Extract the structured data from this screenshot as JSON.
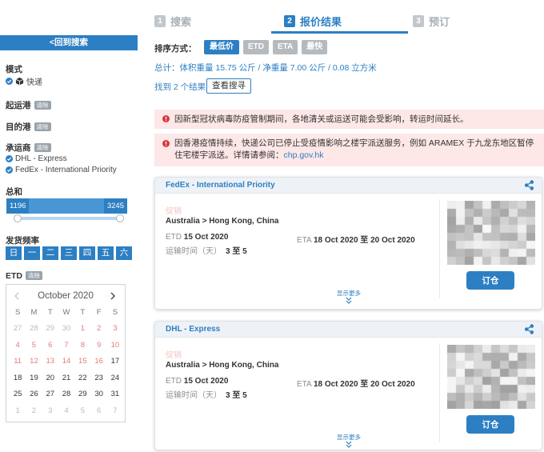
{
  "colors": {
    "primary": "#2d7fc3",
    "primary_dark": "#236aa6",
    "alert_bg": "#fde7e7",
    "alert_red": "#d9363e",
    "step_gray": "#c2c7cc",
    "btn_gray": "#b5babf",
    "past_day": "#e27d7d",
    "promo": "#f3c3c3"
  },
  "icons": {
    "mode": "cube-icon",
    "check": "check-circle-icon",
    "alert": "exclamation-circle-icon",
    "share": "share-icon",
    "more": "double-chevron-down-icon"
  },
  "steps": [
    {
      "num": "1",
      "label": "搜索",
      "active": false
    },
    {
      "num": "2",
      "label": "报价结果",
      "active": true
    },
    {
      "num": "3",
      "label": "预订",
      "active": false
    }
  ],
  "sidebar": {
    "back_button": "<回到搜索",
    "mode": {
      "label": "模式",
      "value": "快递"
    },
    "origin": {
      "label": "起运港",
      "clear": "清除"
    },
    "destination": {
      "label": "目的港",
      "clear": "清除"
    },
    "carrier": {
      "label": "承运商",
      "clear": "清除",
      "options": [
        "DHL - Express",
        "FedEx - International Priority"
      ]
    },
    "total": {
      "label": "总和",
      "min": "1196",
      "max": "3245"
    },
    "frequency": {
      "label": "发货频率",
      "days": [
        "日",
        "一",
        "二",
        "三",
        "四",
        "五",
        "六"
      ]
    },
    "etd": {
      "label": "ETD",
      "clear": "清除"
    },
    "calendar": {
      "month": "October 2020",
      "weekdays": [
        "S",
        "M",
        "T",
        "W",
        "T",
        "F",
        "S"
      ],
      "weeks": [
        [
          {
            "d": "27",
            "muted": true
          },
          {
            "d": "28",
            "muted": true
          },
          {
            "d": "29",
            "muted": true
          },
          {
            "d": "30",
            "muted": true
          },
          {
            "d": "1",
            "past": true
          },
          {
            "d": "2",
            "past": true
          },
          {
            "d": "3",
            "past": true
          }
        ],
        [
          {
            "d": "4",
            "past": true
          },
          {
            "d": "5",
            "past": true
          },
          {
            "d": "6",
            "past": true
          },
          {
            "d": "7",
            "past": true
          },
          {
            "d": "8",
            "past": true
          },
          {
            "d": "9",
            "past": true
          },
          {
            "d": "10",
            "past": true
          }
        ],
        [
          {
            "d": "11",
            "past": true
          },
          {
            "d": "12",
            "past": true
          },
          {
            "d": "13",
            "past": true
          },
          {
            "d": "14",
            "past": true
          },
          {
            "d": "15",
            "past": true
          },
          {
            "d": "16",
            "past": true
          },
          {
            "d": "17"
          }
        ],
        [
          {
            "d": "18"
          },
          {
            "d": "19"
          },
          {
            "d": "20"
          },
          {
            "d": "21"
          },
          {
            "d": "22"
          },
          {
            "d": "23"
          },
          {
            "d": "24"
          }
        ],
        [
          {
            "d": "25"
          },
          {
            "d": "26"
          },
          {
            "d": "27"
          },
          {
            "d": "28"
          },
          {
            "d": "29"
          },
          {
            "d": "30"
          },
          {
            "d": "31"
          }
        ],
        [
          {
            "d": "1",
            "muted": true
          },
          {
            "d": "2",
            "muted": true
          },
          {
            "d": "3",
            "muted": true
          },
          {
            "d": "4",
            "muted": true
          },
          {
            "d": "5",
            "muted": true
          },
          {
            "d": "6",
            "muted": true
          },
          {
            "d": "7",
            "muted": true
          }
        ]
      ]
    }
  },
  "sort": {
    "label": "排序方式：",
    "options": [
      "最低价",
      "ETD",
      "ETA",
      "最快"
    ],
    "active_index": 0
  },
  "summary": "总计：体积重量 15.75 公斤 / 净重量 7.00 公斤 / 0.08 立方米",
  "results": {
    "count_text": "找到 2 个结果",
    "view_search": "查看搜寻"
  },
  "alerts": [
    {
      "text": "因新型冠状病毒防疫管制期间，各地清关或运送可能会受影响，转运时间延长。"
    },
    {
      "text": "因香港疫情持续，快递公司已停止受疫情影响之楼宇派送服务，例如 ARAMEX 于九龙东地区暂停住宅楼宇派送。详情请参阅：",
      "link": "chp.gov.hk"
    }
  ],
  "cards": [
    {
      "carrier": "FedEx - International Priority",
      "promo": "促销",
      "route": "Australia > Hong Kong, China",
      "etd": {
        "label": "ETD",
        "value": "15 Oct 2020"
      },
      "eta": {
        "label": "ETA",
        "value": "18 Oct 2020 至 20 Oct 2020"
      },
      "transit": {
        "label": "运输时间（天）",
        "value": "3 至 5"
      },
      "book": "订仓",
      "more": "显示更多"
    },
    {
      "carrier": "DHL - Express",
      "promo": "促销",
      "route": "Australia > Hong Kong, China",
      "etd": {
        "label": "ETD",
        "value": "15 Oct 2020"
      },
      "eta": {
        "label": "ETA",
        "value": "18 Oct 2020 至 20 Oct 2020"
      },
      "transit": {
        "label": "运输时间（天）",
        "value": "3 至 5"
      },
      "book": "订仓",
      "more": "显示更多"
    }
  ]
}
